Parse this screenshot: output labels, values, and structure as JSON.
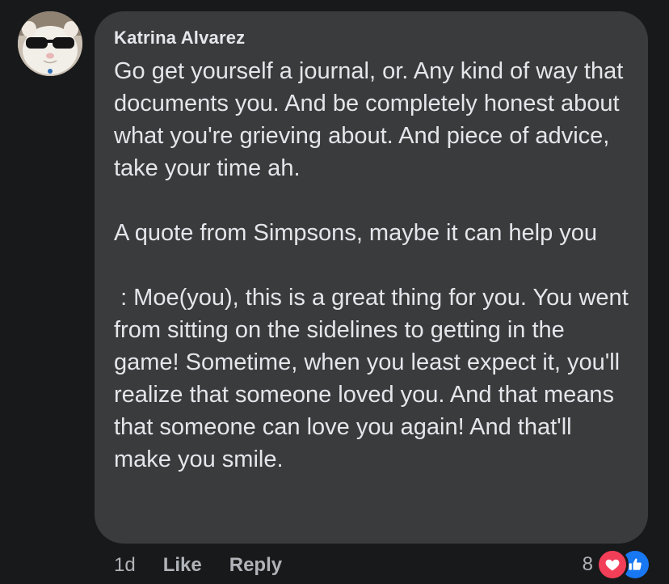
{
  "comment": {
    "author": "Katrina Alvarez",
    "paragraphs": [
      "Go get yourself a journal, or. Any kind of way that documents you. And be completely honest about what you're grieving about. And piece of advice, take your time ah.",
      "A quote from Simpsons, maybe it can help you",
      " : Moe(you), this is a great thing for you. You went from sitting on the sidelines to getting in the game! Sometime, when you least expect it, you'll realize that someone loved you. And that means that someone can love you again! And that'll make you smile."
    ],
    "timestamp": "1d",
    "like_label": "Like",
    "reply_label": "Reply",
    "reaction_count": "8",
    "reactions": [
      "love-icon",
      "like-icon"
    ]
  },
  "colors": {
    "background": "#18191a",
    "bubble": "#3a3b3c",
    "text": "#e4e6eb",
    "muted": "#b0b3b8",
    "love": "#f33e58",
    "like": "#1877f2"
  }
}
